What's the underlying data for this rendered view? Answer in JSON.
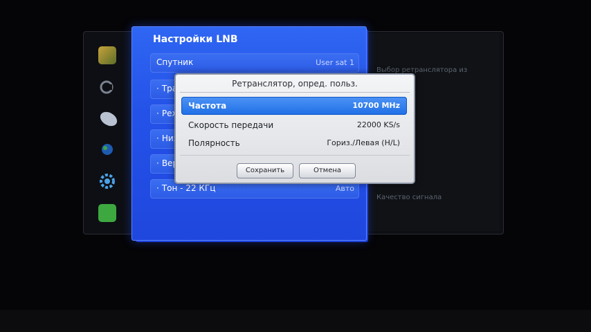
{
  "settings_panel": {
    "title": "Настройки LNB",
    "items": [
      {
        "label": "Спутник",
        "value": "User sat 1"
      },
      {
        "label": "Тра"
      },
      {
        "label": "Реж"
      },
      {
        "label": "Низ"
      },
      {
        "label": "Вер"
      },
      {
        "label": "Тон - 22 КГц",
        "value": "Авто"
      }
    ]
  },
  "right_panel": {
    "line1": "Выбор ретранслятора из",
    "line2": "Качество сигнала"
  },
  "dialog": {
    "title": "Ретранслятор, опред. польз.",
    "rows": [
      {
        "label": "Частота",
        "value": "10700 MHz"
      },
      {
        "label": "Скорость передачи",
        "value": "22000 KS/s"
      },
      {
        "label": "Полярность",
        "value": "Гориз./Левая (H/L)"
      }
    ],
    "save_label": "Сохранить",
    "cancel_label": "Отмена"
  },
  "colors": {
    "panel_blue": "#2452e8",
    "highlight_blue": "#1f6fe6",
    "dialog_bg": "#e8e9ec"
  },
  "icons": [
    "picture-icon",
    "sound-icon",
    "broadcast-icon",
    "network-icon",
    "settings-gear-icon",
    "support-icon"
  ]
}
